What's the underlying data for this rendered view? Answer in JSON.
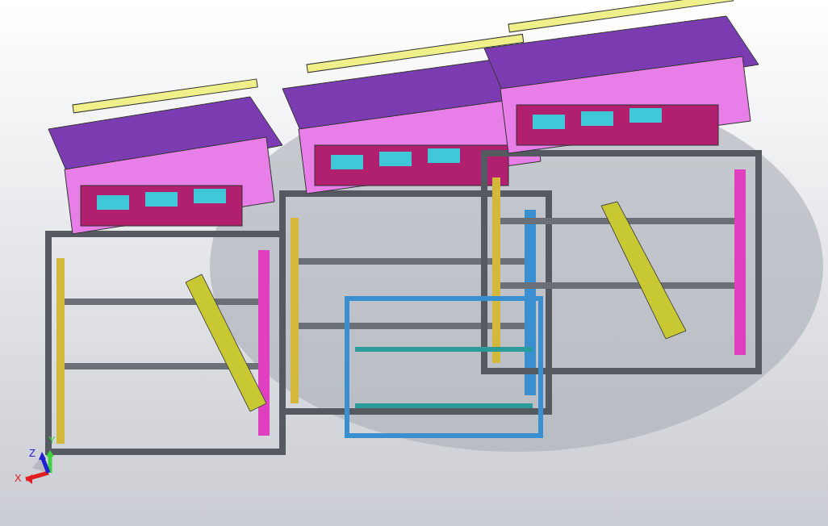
{
  "viewport": {
    "triad": {
      "axes": [
        {
          "label": "X",
          "color": "#e02020"
        },
        {
          "label": "Y",
          "color": "#40d040"
        },
        {
          "label": "Z",
          "color": "#2020d0"
        }
      ]
    }
  }
}
